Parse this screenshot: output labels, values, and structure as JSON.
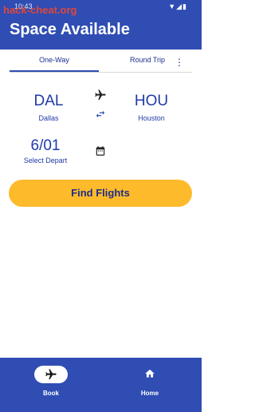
{
  "watermark": "hack-cheat.org",
  "status_bar": {
    "time": "10:43",
    "icons": "▼◢▮"
  },
  "header": {
    "title": "Space Available"
  },
  "tabs": [
    {
      "label": "One-Way",
      "selected": true
    },
    {
      "label": "Round Trip",
      "selected": false
    }
  ],
  "menu": {
    "icon": "kebab-menu-icon",
    "glyph": "⋮"
  },
  "route": {
    "from": {
      "code": "DAL",
      "city": "Dallas"
    },
    "to": {
      "code": "HOU",
      "city": "Houston"
    }
  },
  "date": {
    "value": "6/01",
    "label": "Select Depart"
  },
  "find_button": {
    "label": "Find Flights"
  },
  "bottom_nav": [
    {
      "label": "Book",
      "icon": "airplane-icon",
      "selected": true
    },
    {
      "label": "Home",
      "icon": "home-icon",
      "selected": false
    }
  ],
  "colors": {
    "primary": "#2f4db3",
    "accent": "#fdbb2c",
    "text": "#1f3aa7"
  }
}
